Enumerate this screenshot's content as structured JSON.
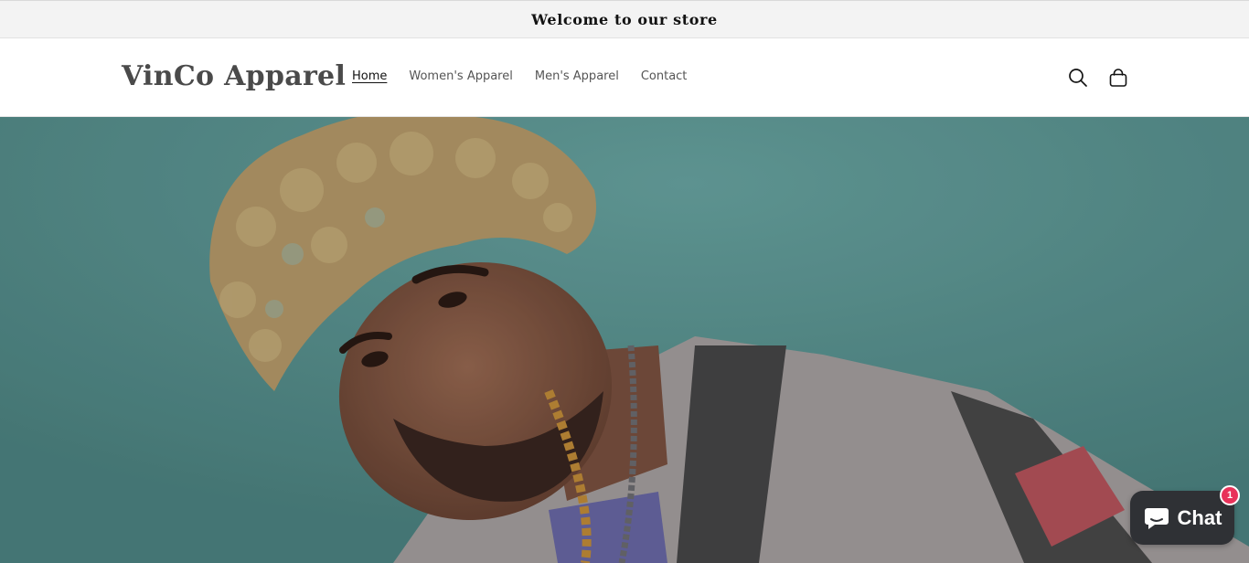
{
  "announcement": {
    "text": "Welcome to our store"
  },
  "header": {
    "logo": "VinCo Apparel",
    "nav": [
      {
        "label": "Home",
        "active": true
      },
      {
        "label": "Women's Apparel",
        "active": false
      },
      {
        "label": "Men's Apparel",
        "active": false
      },
      {
        "label": "Contact",
        "active": false
      }
    ],
    "icons": {
      "search": "search-icon",
      "cart": "cart-icon"
    }
  },
  "hero": {
    "image": "hero-image",
    "background_color": "#5a9491"
  },
  "chat": {
    "label": "Chat",
    "badge": "1",
    "badge_color": "#e8325a",
    "button_color": "#2f3135"
  }
}
